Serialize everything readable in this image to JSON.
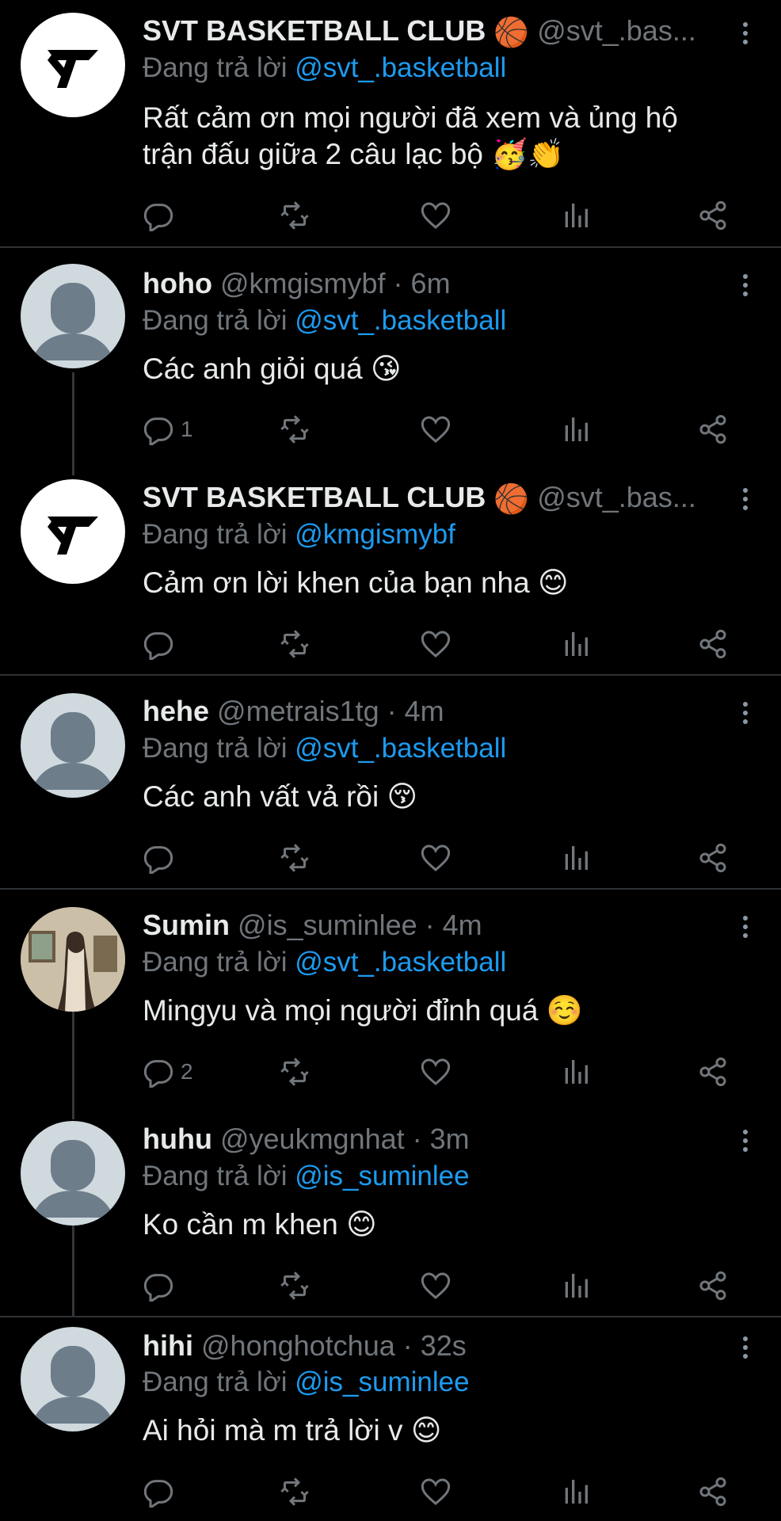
{
  "tweets": [
    {
      "name": "SVT BASKETBALL CLUB",
      "name_emoji": "🏀",
      "handle": "@svt_.bas...",
      "time": "",
      "replying_label": "Đang trả lời",
      "replying_to": "@svt_.basketball",
      "text": "Rất cảm ơn mọi người đã xem và ủng hộ trận đấu giữa 2 câu lạc bộ 🥳👏",
      "avatar": "logo",
      "reply_count": ""
    },
    {
      "name": "hoho",
      "name_emoji": "",
      "handle": "@kmgismybf · 6m",
      "time": "",
      "replying_label": "Đang trả lời",
      "replying_to": "@svt_.basketball",
      "text": "Các anh giỏi quá 😘",
      "avatar": "default",
      "reply_count": "1"
    },
    {
      "name": "SVT BASKETBALL CLUB",
      "name_emoji": "🏀",
      "handle": "@svt_.bas...",
      "time": "",
      "replying_label": "Đang trả lời",
      "replying_to": "@kmgismybf",
      "text": "Cảm ơn lời khen của bạn nha 😊",
      "avatar": "logo",
      "reply_count": ""
    },
    {
      "name": "hehe",
      "name_emoji": "",
      "handle": "@metrais1tg · 4m",
      "time": "",
      "replying_label": "Đang trả lời",
      "replying_to": "@svt_.basketball",
      "text": "Các anh vất vả rồi 😚",
      "avatar": "default",
      "reply_count": ""
    },
    {
      "name": "Sumin",
      "name_emoji": "",
      "handle": "@is_suminlee · 4m",
      "time": "",
      "replying_label": "Đang trả lời",
      "replying_to": "@svt_.basketball",
      "text": "Mingyu và mọi người đỉnh quá ☺️",
      "avatar": "photo",
      "reply_count": "2"
    },
    {
      "name": "huhu",
      "name_emoji": "",
      "handle": "@yeukmgnhat · 3m",
      "time": "",
      "replying_label": "Đang trả lời",
      "replying_to": "@is_suminlee",
      "text": "Ko cần m khen 😊",
      "avatar": "default",
      "reply_count": ""
    },
    {
      "name": "hihi",
      "name_emoji": "",
      "handle": "@honghotchua · 32s",
      "time": "",
      "replying_label": "Đang trả lời",
      "replying_to": "@is_suminlee",
      "text": "Ai hỏi mà m trả lời v 😊",
      "avatar": "default",
      "reply_count": ""
    }
  ],
  "icons": [
    "reply-icon",
    "retweet-icon",
    "like-icon",
    "views-icon",
    "share-icon",
    "more-options-icon"
  ],
  "colors": {
    "background": "#000000",
    "mention": "#1d9bf0",
    "muted": "#71767b",
    "separator": "#2f3336"
  }
}
